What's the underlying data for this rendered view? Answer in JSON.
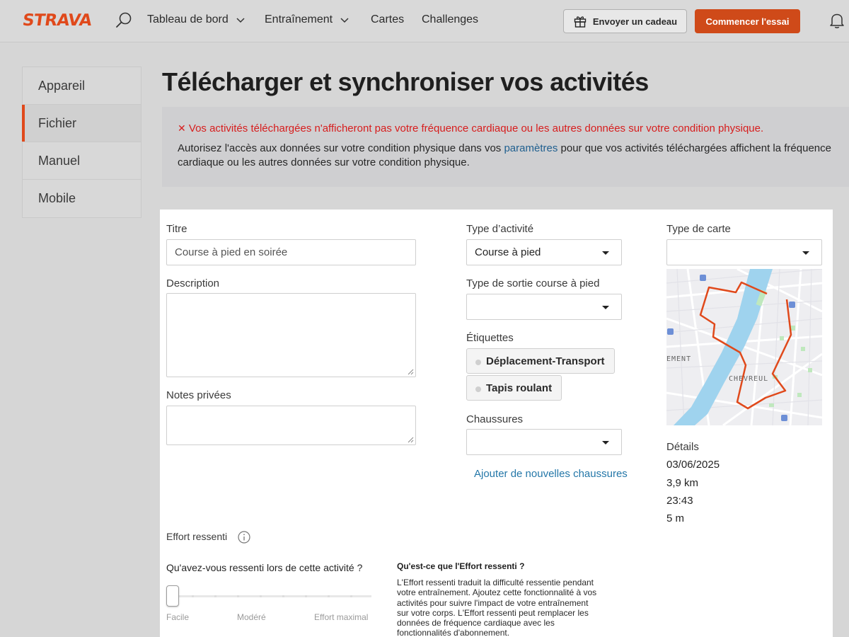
{
  "header": {
    "logo": "STRAVA",
    "nav": [
      "Tableau de bord",
      "Entraînement",
      "Cartes",
      "Challenges"
    ],
    "gift_label": "Envoyer un cadeau",
    "trial_label": "Commencer l'essai"
  },
  "sidebar": {
    "items": [
      {
        "label": "Appareil"
      },
      {
        "label": "Fichier"
      },
      {
        "label": "Manuel"
      },
      {
        "label": "Mobile"
      }
    ],
    "active": "Fichier"
  },
  "page_title": "Télécharger et synchroniser vos activités",
  "alert": {
    "error": "Vos activités téléchargées n'afficheront pas votre fréquence cardiaque ou les autres données sur votre condition physique.",
    "text_before": "Autorisez l'accès aux données sur votre condition physique dans vos ",
    "link": "paramètres",
    "text_after": " pour que vos activités téléchargées affichent la fréquence cardiaque ou les autres données sur votre condition physique."
  },
  "form": {
    "title_label": "Titre",
    "title_value": "Course à pied en soirée",
    "description_label": "Description",
    "private_notes_label": "Notes privées",
    "activity_type_label": "Type d’activité",
    "activity_type_value": "Course à pied",
    "run_type_label": "Type de sortie course à pied",
    "run_type_value": "",
    "tags_label": "Étiquettes",
    "tags": [
      "Déplacement-Transport",
      "Tapis roulant"
    ],
    "shoes_label": "Chaussures",
    "shoes_value": "",
    "add_shoes_link": "Ajouter de nouvelles chaussures",
    "map_type_label": "Type de carte",
    "map_type_value": "",
    "map_labels": [
      "EMENT",
      "CHEVREUL"
    ],
    "details_label": "Détails",
    "details": {
      "date": "03/06/2025",
      "distance": "3,9 km",
      "time": "23:43",
      "elevation": "5 m"
    }
  },
  "effort": {
    "label": "Effort ressenti",
    "question": "Qu'avez-vous ressenti lors de cette activité ?",
    "scale": [
      "Facile",
      "Modéré",
      "Effort maximal"
    ],
    "value": 0,
    "info_title": "Qu'est-ce que l'Effort ressenti ?",
    "info_body": "L'Effort ressenti traduit la difficulté ressentie pendant votre entraînement. Ajoutez cette fonctionnalité à vos activités pour suivre l'impact de votre entraînement sur votre corps. L'Effort ressenti peut remplacer les données de fréquence cardiaque avec les fonctionnalités d'abonnement."
  },
  "colors": {
    "brand": "#e0491b",
    "error": "#d71d1d",
    "link": "#2477a8",
    "route": "#e0491b",
    "water": "#9fd3ee"
  }
}
